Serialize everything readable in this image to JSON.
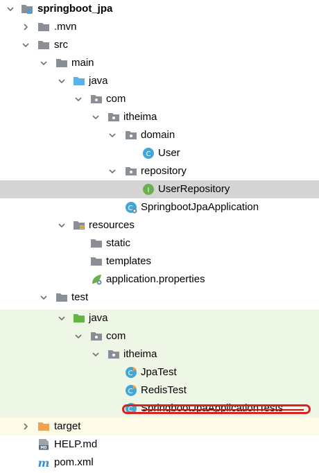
{
  "colors": {
    "folder_gray": "#8a8f96",
    "folder_blue": "#5ab0e8",
    "folder_green": "#62b543",
    "folder_orange": "#f0a24d",
    "class_blue": "#40a7d8",
    "interface_green": "#6ab04c",
    "selection": "#d4d4d4",
    "test_background": "#eef7e6",
    "annotation_red": "#e02020"
  },
  "tree": {
    "project": "springboot_jpa",
    "mvn": ".mvn",
    "src": "src",
    "main": "main",
    "main_java": "java",
    "main_com": "com",
    "main_itheima": "itheima",
    "domain": "domain",
    "user": "User",
    "repository": "repository",
    "user_repository": "UserRepository",
    "app": "SpringbootJpaApplication",
    "resources": "resources",
    "static": "static",
    "templates": "templates",
    "app_properties": "application.properties",
    "test": "test",
    "test_java": "java",
    "test_com": "com",
    "test_itheima": "itheima",
    "jpa_test": "JpaTest",
    "redis_test": "RedisTest",
    "app_tests": "SpringbootJpaApplicationTests",
    "target": "target",
    "help": "HELP.md",
    "pom": "pom.xml"
  }
}
